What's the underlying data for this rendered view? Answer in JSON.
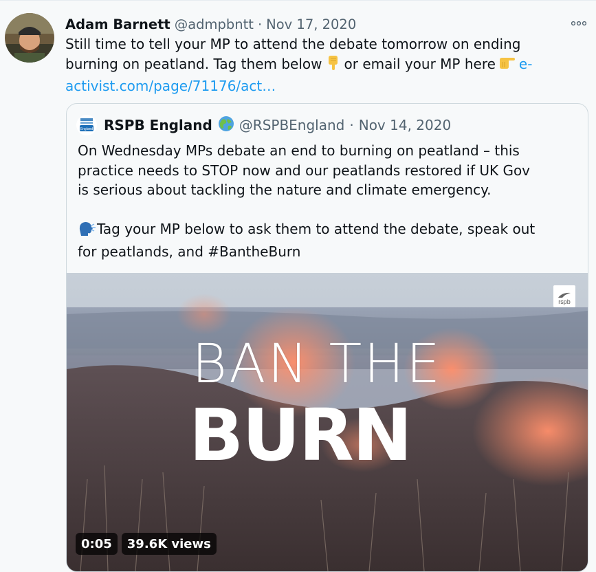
{
  "tweet": {
    "author_name": "Adam Barnett",
    "author_handle": "@admpbntt",
    "separator": "·",
    "date": "Nov 17, 2020",
    "text_line1": "Still time to tell your MP to attend the debate tomorrow on ending",
    "text_line2_a": "burning on peatland. Tag them below",
    "text_line2_b": "or email your MP here",
    "link_part1": "e-",
    "link_part2": "activist.com/page/71176/act…",
    "more_icon": "ellipsis-icon"
  },
  "quote": {
    "author_name": "RSPB England",
    "author_handle": "@RSPBEngland",
    "separator": "·",
    "date": "Nov 14, 2020",
    "line1": "On Wednesday MPs debate an end to burning on peatland – this",
    "line2": "practice needs to STOP now and our peatlands restored if UK Gov",
    "line3": "is serious about tackling the nature and climate emergency.",
    "line4": "Tag your MP below to ask them to attend the debate, speak out",
    "line5": "for peatlands, and #BantheBurn",
    "avatar_label": "England"
  },
  "media": {
    "overlay_line1": "BAN THE",
    "overlay_line2": "BURN",
    "watermark": "rspb",
    "duration": "0:05",
    "views": "39.6K views"
  },
  "colors": {
    "link": "#1d9bf0",
    "secondary_text": "#536471",
    "border": "#cfd9de",
    "background": "#f7f9fa"
  }
}
